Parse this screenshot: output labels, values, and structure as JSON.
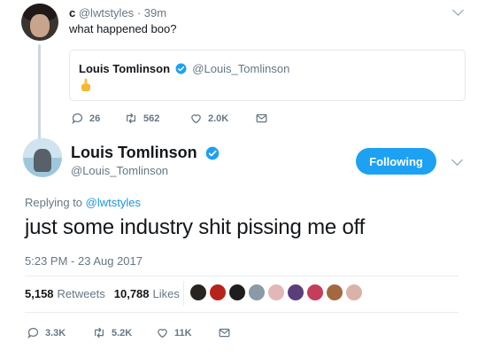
{
  "reply_tweet": {
    "name": "c",
    "handle": "@lwtstyles",
    "dot": "·",
    "time": "39m",
    "text": "what happened boo?",
    "quote": {
      "name": "Louis Tomlinson",
      "handle": "@Louis_Tomlinson",
      "emoji": "middle-finger-emoji"
    },
    "actions": {
      "replies": "26",
      "retweets": "562",
      "likes": "2.0K"
    }
  },
  "main_tweet": {
    "name": "Louis Tomlinson",
    "handle": "@Louis_Tomlinson",
    "follow_label": "Following",
    "replying_prefix": "Replying to",
    "replying_to": "@lwtstyles",
    "text": "just some industry shit pissing me off",
    "timestamp": "5:23 PM - 23 Aug 2017",
    "stats": {
      "retweets_count": "5,158",
      "retweets_label": "Retweets",
      "likes_count": "10,788",
      "likes_label": "Likes"
    },
    "likers": [
      "#2a2420",
      "#b5231b",
      "#1e1e1e",
      "#8a9aa6",
      "#e3b6b8",
      "#5a3e7a",
      "#c43d5a",
      "#a3683f",
      "#d9b3a8"
    ],
    "actions": {
      "replies": "3.3K",
      "retweets": "5.2K",
      "likes": "11K"
    }
  },
  "colors": {
    "accent": "#1da1f2",
    "link": "#1b95e0",
    "muted": "#657786",
    "verified": "#1da1f2"
  }
}
